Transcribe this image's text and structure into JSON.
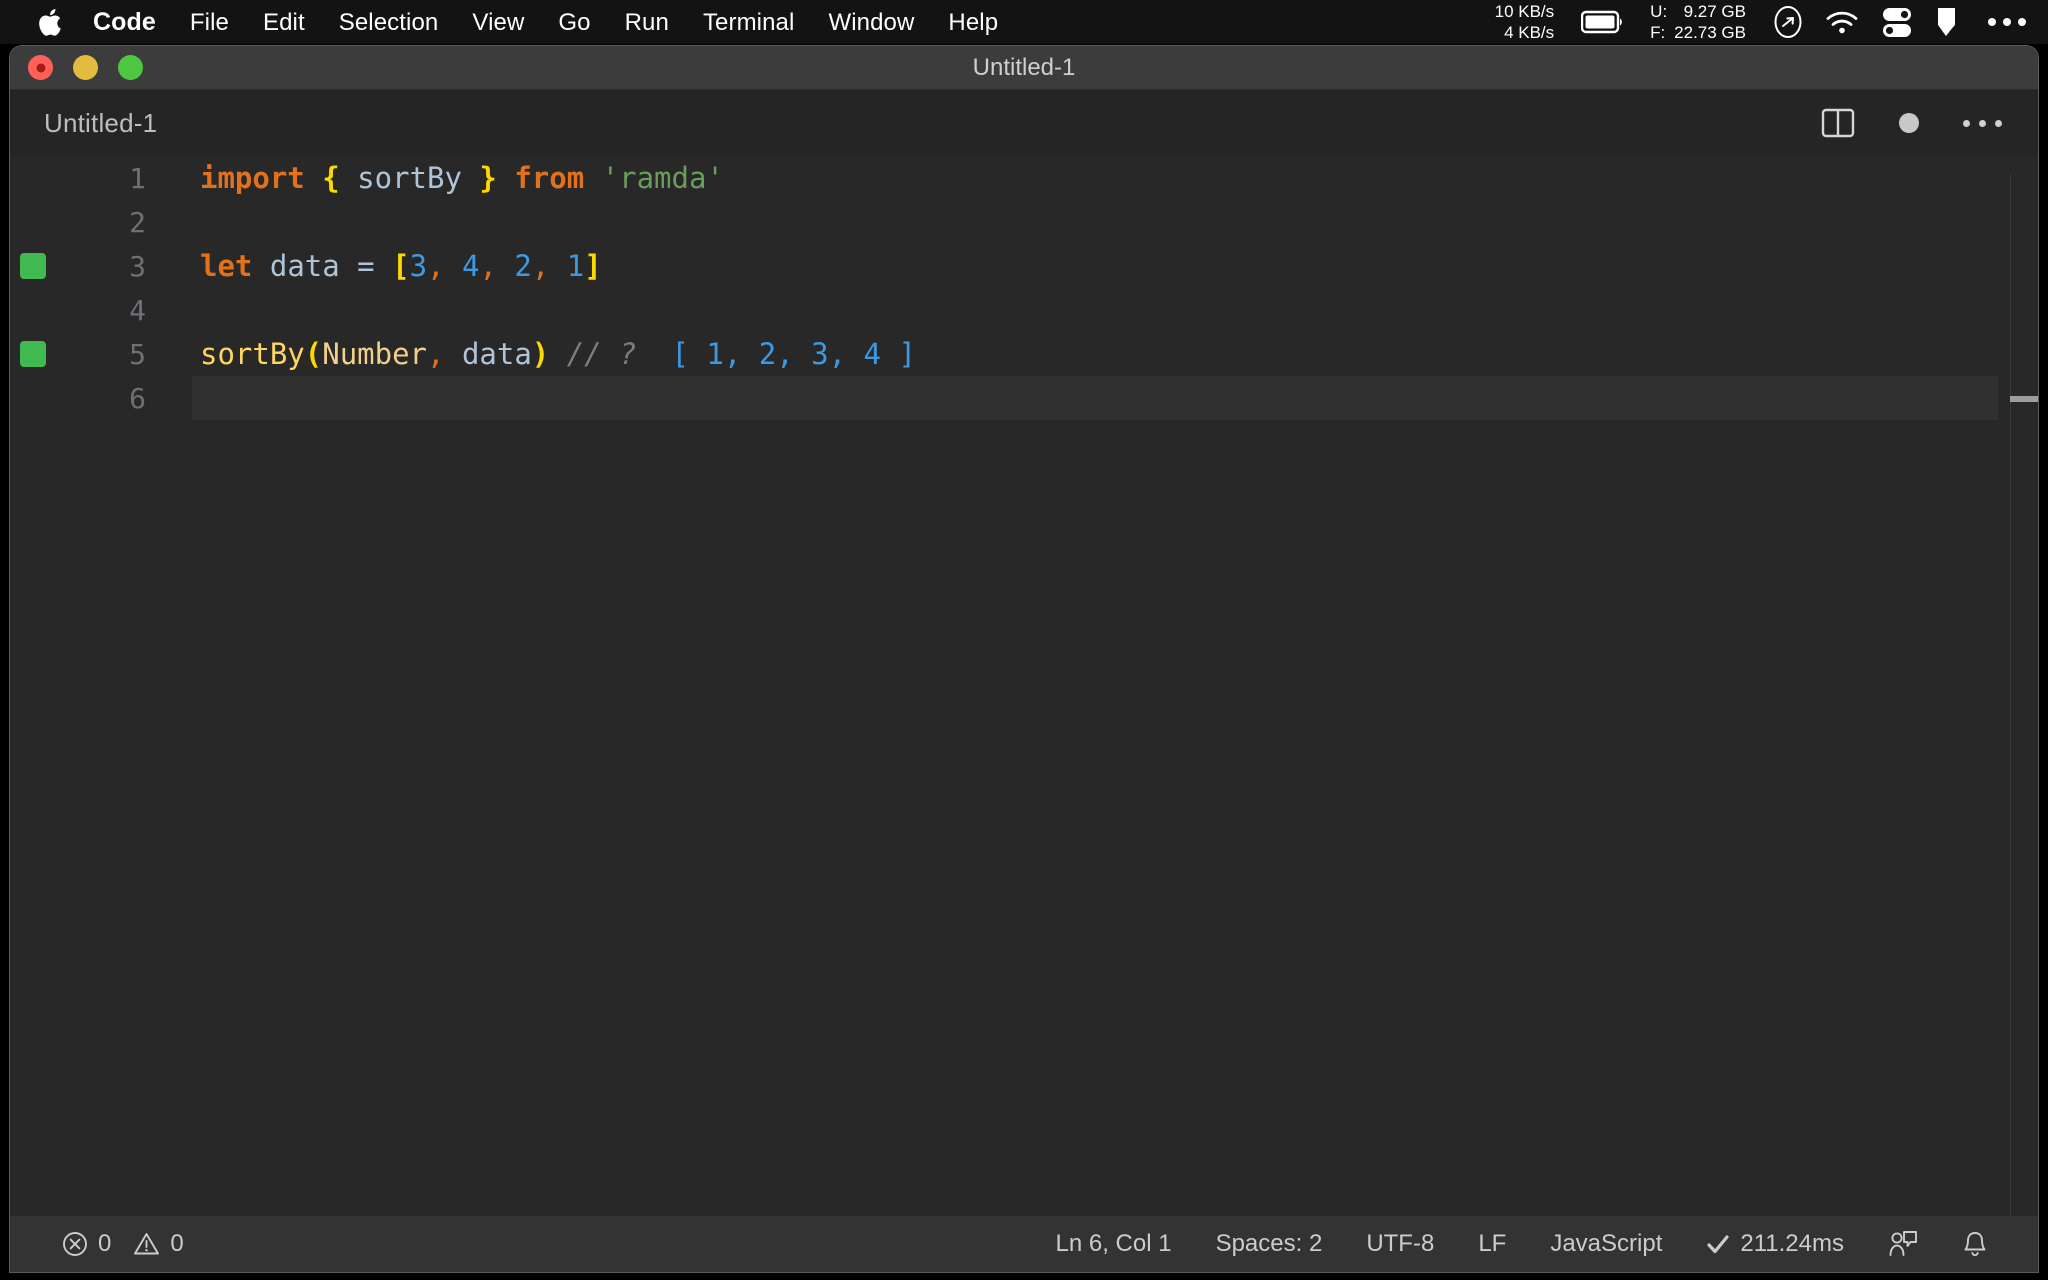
{
  "menubar": {
    "apple_icon": "apple-logo-icon",
    "items": [
      {
        "label": "Code",
        "bold": true
      },
      {
        "label": "File",
        "bold": false
      },
      {
        "label": "Edit",
        "bold": false
      },
      {
        "label": "Selection",
        "bold": false
      },
      {
        "label": "View",
        "bold": false
      },
      {
        "label": "Go",
        "bold": false
      },
      {
        "label": "Run",
        "bold": false
      },
      {
        "label": "Terminal",
        "bold": false
      },
      {
        "label": "Window",
        "bold": false
      },
      {
        "label": "Help",
        "bold": false
      }
    ],
    "network": {
      "up": "10 KB/s",
      "down": "4 KB/s"
    },
    "battery_icon": "battery-icon",
    "memory": {
      "used_label": "U:",
      "used_value": "9.27 GB",
      "free_label": "F:",
      "free_value": "22.73 GB"
    },
    "icons": [
      "compass-icon",
      "wifi-icon",
      "toggles-icon",
      "flag-icon",
      "more-icon"
    ]
  },
  "window": {
    "title": "Untitled-1",
    "traffic_lights": [
      "close-button",
      "minimize-button",
      "zoom-button"
    ]
  },
  "editor_header": {
    "tab_label": "Untitled-1",
    "actions": [
      "split-editor-icon",
      "unsaved-indicator",
      "more-actions-icon"
    ]
  },
  "editor": {
    "lines": [
      {
        "number": "1",
        "marked": false,
        "active": false,
        "tokens": [
          {
            "text": "import",
            "type": "key"
          },
          {
            "text": " ",
            "type": "op"
          },
          {
            "text": "{",
            "type": "brace"
          },
          {
            "text": " ",
            "type": "op"
          },
          {
            "text": "sortBy",
            "type": "id"
          },
          {
            "text": " ",
            "type": "op"
          },
          {
            "text": "}",
            "type": "brace"
          },
          {
            "text": " ",
            "type": "op"
          },
          {
            "text": "from",
            "type": "key"
          },
          {
            "text": " ",
            "type": "op"
          },
          {
            "text": "'ramda'",
            "type": "str"
          }
        ]
      },
      {
        "number": "2",
        "marked": false,
        "active": false,
        "tokens": []
      },
      {
        "number": "3",
        "marked": true,
        "active": false,
        "tokens": [
          {
            "text": "let",
            "type": "key"
          },
          {
            "text": " ",
            "type": "op"
          },
          {
            "text": "data",
            "type": "id"
          },
          {
            "text": " ",
            "type": "op"
          },
          {
            "text": "=",
            "type": "op"
          },
          {
            "text": " ",
            "type": "op"
          },
          {
            "text": "[",
            "type": "brace"
          },
          {
            "text": "3",
            "type": "num"
          },
          {
            "text": ",",
            "type": "punc"
          },
          {
            "text": " ",
            "type": "op"
          },
          {
            "text": "4",
            "type": "num"
          },
          {
            "text": ",",
            "type": "punc"
          },
          {
            "text": " ",
            "type": "op"
          },
          {
            "text": "2",
            "type": "num"
          },
          {
            "text": ",",
            "type": "punc"
          },
          {
            "text": " ",
            "type": "op"
          },
          {
            "text": "1",
            "type": "num"
          },
          {
            "text": "]",
            "type": "brace"
          }
        ]
      },
      {
        "number": "4",
        "marked": false,
        "active": false,
        "tokens": []
      },
      {
        "number": "5",
        "marked": true,
        "active": false,
        "tokens": [
          {
            "text": "sortBy",
            "type": "func"
          },
          {
            "text": "(",
            "type": "brace"
          },
          {
            "text": "Number",
            "type": "param"
          },
          {
            "text": ",",
            "type": "punc"
          },
          {
            "text": " ",
            "type": "op"
          },
          {
            "text": "data",
            "type": "id"
          },
          {
            "text": ")",
            "type": "brace"
          },
          {
            "text": " ",
            "type": "op"
          },
          {
            "text": "// ?",
            "type": "cmt"
          },
          {
            "text": "  ",
            "type": "op"
          },
          {
            "text": "[ 1, 2, 3, 4 ]",
            "type": "out"
          }
        ]
      },
      {
        "number": "6",
        "marked": false,
        "active": true,
        "tokens": []
      }
    ]
  },
  "statusbar": {
    "errors": {
      "icon": "error-icon",
      "count": "0"
    },
    "warnings": {
      "icon": "warning-icon",
      "count": "0"
    },
    "cursor_position": "Ln 6, Col 1",
    "indentation": "Spaces: 2",
    "encoding": "UTF-8",
    "eol": "LF",
    "language": "JavaScript",
    "runtime": "211.24ms",
    "runtime_icon": "check-icon",
    "feedback_icon": "feedback-icon",
    "bell_icon": "bell-icon"
  },
  "colors": {
    "menubar_bg": "#131313",
    "titlebar_bg": "#3c3c3c",
    "editor_bg": "#282828",
    "statusbar_bg": "#333333",
    "marker_green": "#3fb950",
    "keyword_orange": "#e2711d",
    "brace_yellow": "#ffd700",
    "number_blue": "#3d9ae2",
    "string_green": "#6a9c5a",
    "identifier_blue": "#b0c4d8",
    "comment_grey": "#7d7d7d"
  }
}
